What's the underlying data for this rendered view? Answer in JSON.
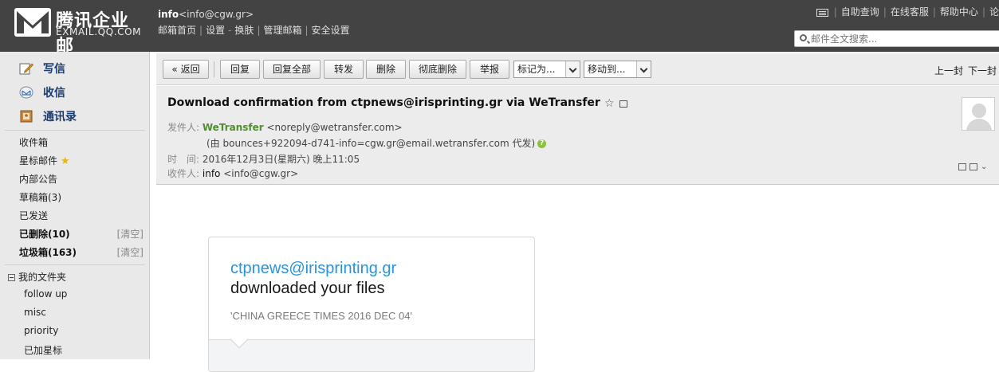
{
  "brand": {
    "title": "腾讯企业邮",
    "subtitle": "EXMAIL.QQ.COM"
  },
  "account": {
    "name": "info",
    "email": "<info@cgw.gr>",
    "links": [
      "邮箱首页",
      "设置",
      "换肤",
      "管理邮箱",
      "安全设置"
    ],
    "settings_sep": "-"
  },
  "top_links": [
    "自助查询",
    "在线客服",
    "帮助中心",
    "论"
  ],
  "search": {
    "placeholder": "邮件全文搜索..."
  },
  "sidebar": {
    "compose": "写信",
    "inbox": "收信",
    "contacts": "通讯录",
    "folders": [
      {
        "label": "收件箱"
      },
      {
        "label": "星标邮件"
      },
      {
        "label": "内部公告"
      },
      {
        "label": "草稿箱(3)"
      },
      {
        "label": "已发送"
      },
      {
        "label": "已删除(10)",
        "action": "[清空]"
      },
      {
        "label": "垃圾箱(163)",
        "action": "[清空]"
      }
    ],
    "my_folders": "我的文件夹",
    "custom_folders": [
      "follow up",
      "misc",
      "priority",
      "已加星标"
    ]
  },
  "toolbar": {
    "back": "« 返回",
    "reply": "回复",
    "reply_all": "回复全部",
    "forward": "转发",
    "delete": "删除",
    "delete_perm": "彻底删除",
    "report": "举报",
    "mark_as": "标记为...",
    "move_to": "移动到...",
    "prev": "上一封",
    "next": "下一封"
  },
  "mail": {
    "subject": "Download confirmation from ctpnews@irisprinting.gr via WeTransfer",
    "from_label": "发件人:",
    "from_name": "WeTransfer",
    "from_email": "<noreply@wetransfer.com>",
    "proxy": "(由 bounces+922094-d741-info=cgw.gr@email.wetransfer.com 代发)",
    "time_label": "时　间:",
    "time": "2016年12月3日(星期六) 晚上11:05",
    "to_label": "收件人:",
    "to_name": "info",
    "to_email": "<info@cgw.gr>"
  },
  "card": {
    "sender": "ctpnews@irisprinting.gr",
    "title": "downloaded your files",
    "message": "'CHINA GREECE TIMES 2016 DEC 04'"
  }
}
